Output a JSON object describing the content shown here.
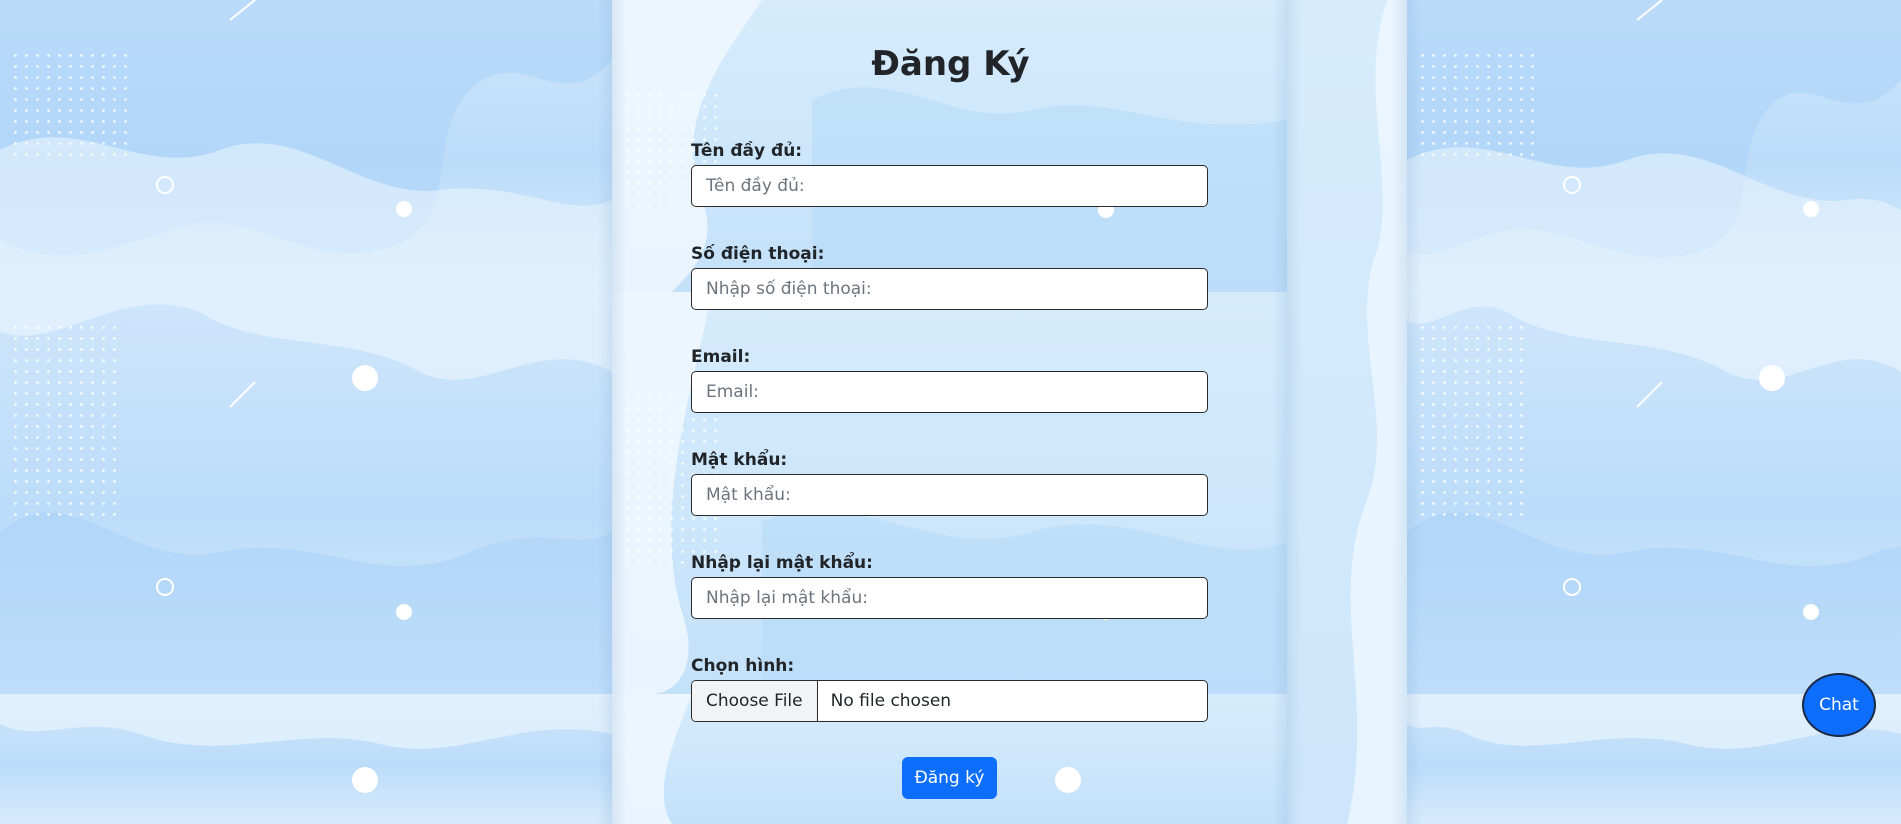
{
  "form": {
    "title": "Đăng Ký",
    "fields": [
      {
        "label": "Tên đầy đủ:",
        "placeholder": "Tên đầy đủ:",
        "type": "text",
        "value": ""
      },
      {
        "label": "Số điện thoại:",
        "placeholder": "Nhập số điện thoại:",
        "type": "tel",
        "value": ""
      },
      {
        "label": "Email:",
        "placeholder": "Email:",
        "type": "email",
        "value": ""
      },
      {
        "label": "Mật khẩu:",
        "placeholder": "Mật khẩu:",
        "type": "password",
        "value": ""
      },
      {
        "label": "Nhập lại mật khẩu:",
        "placeholder": "Nhập lại mật khẩu:",
        "type": "password",
        "value": ""
      }
    ],
    "file": {
      "label": "Chọn hình:",
      "button_label": "Choose File",
      "status": "No file chosen"
    },
    "submit_label": "Đăng ký"
  },
  "chat": {
    "label": "Chat"
  },
  "colors": {
    "primary": "#0d6efd",
    "background": "#d3e9fb",
    "text": "#212529"
  }
}
